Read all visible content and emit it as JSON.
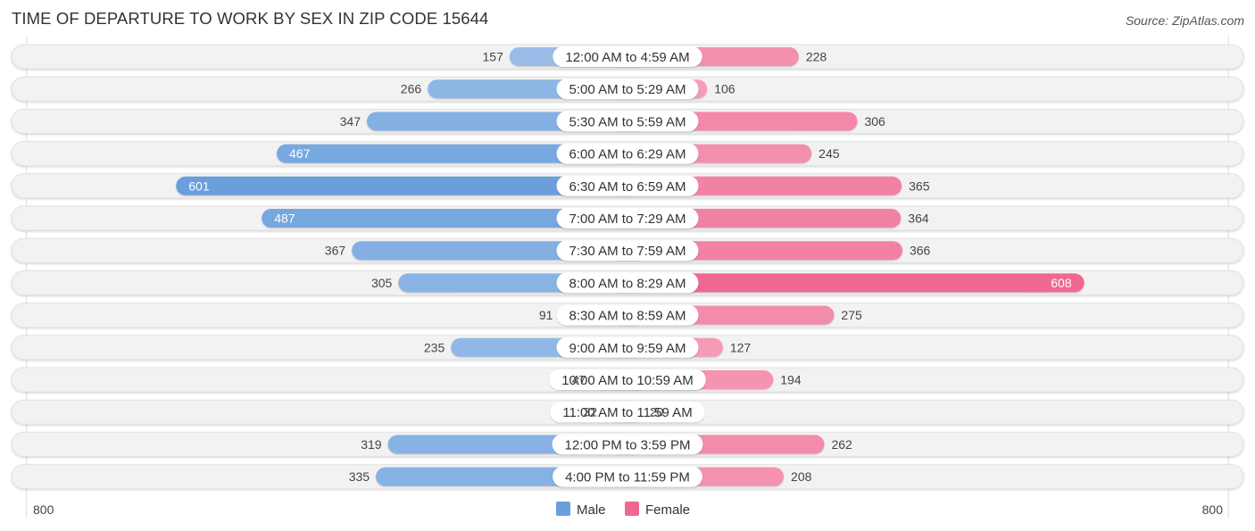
{
  "header": {
    "title": "TIME OF DEPARTURE TO WORK BY SEX IN ZIP CODE 15644",
    "source": "Source: ZipAtlas.com"
  },
  "colors": {
    "male": "#6a9fdc",
    "male_light": "#a9c8ec",
    "female": "#f06890",
    "female_light": "#f6a8c0",
    "row_bg": "#f2f2f2",
    "label_bg": "#ffffff"
  },
  "chart_data": {
    "type": "bar",
    "orientation": "horizontal-diverging",
    "title": "TIME OF DEPARTURE TO WORK BY SEX IN ZIP CODE 15644",
    "categories": [
      "12:00 AM to 4:59 AM",
      "5:00 AM to 5:29 AM",
      "5:30 AM to 5:59 AM",
      "6:00 AM to 6:29 AM",
      "6:30 AM to 6:59 AM",
      "7:00 AM to 7:29 AM",
      "7:30 AM to 7:59 AM",
      "8:00 AM to 8:29 AM",
      "8:30 AM to 8:59 AM",
      "9:00 AM to 9:59 AM",
      "10:00 AM to 10:59 AM",
      "11:00 AM to 11:59 AM",
      "12:00 PM to 3:59 PM",
      "4:00 PM to 11:59 PM"
    ],
    "series": [
      {
        "name": "Male",
        "side": "left",
        "values": [
          157,
          266,
          347,
          467,
          601,
          487,
          367,
          305,
          91,
          235,
          47,
          32,
          319,
          335
        ]
      },
      {
        "name": "Female",
        "side": "right",
        "values": [
          228,
          106,
          306,
          245,
          365,
          364,
          366,
          608,
          275,
          127,
          194,
          20,
          262,
          208
        ]
      }
    ],
    "axis": {
      "left_label": "800",
      "right_label": "800",
      "max": 800
    },
    "legend": {
      "position": "bottom-center",
      "entries": [
        "Male",
        "Female"
      ]
    },
    "grid": false
  }
}
